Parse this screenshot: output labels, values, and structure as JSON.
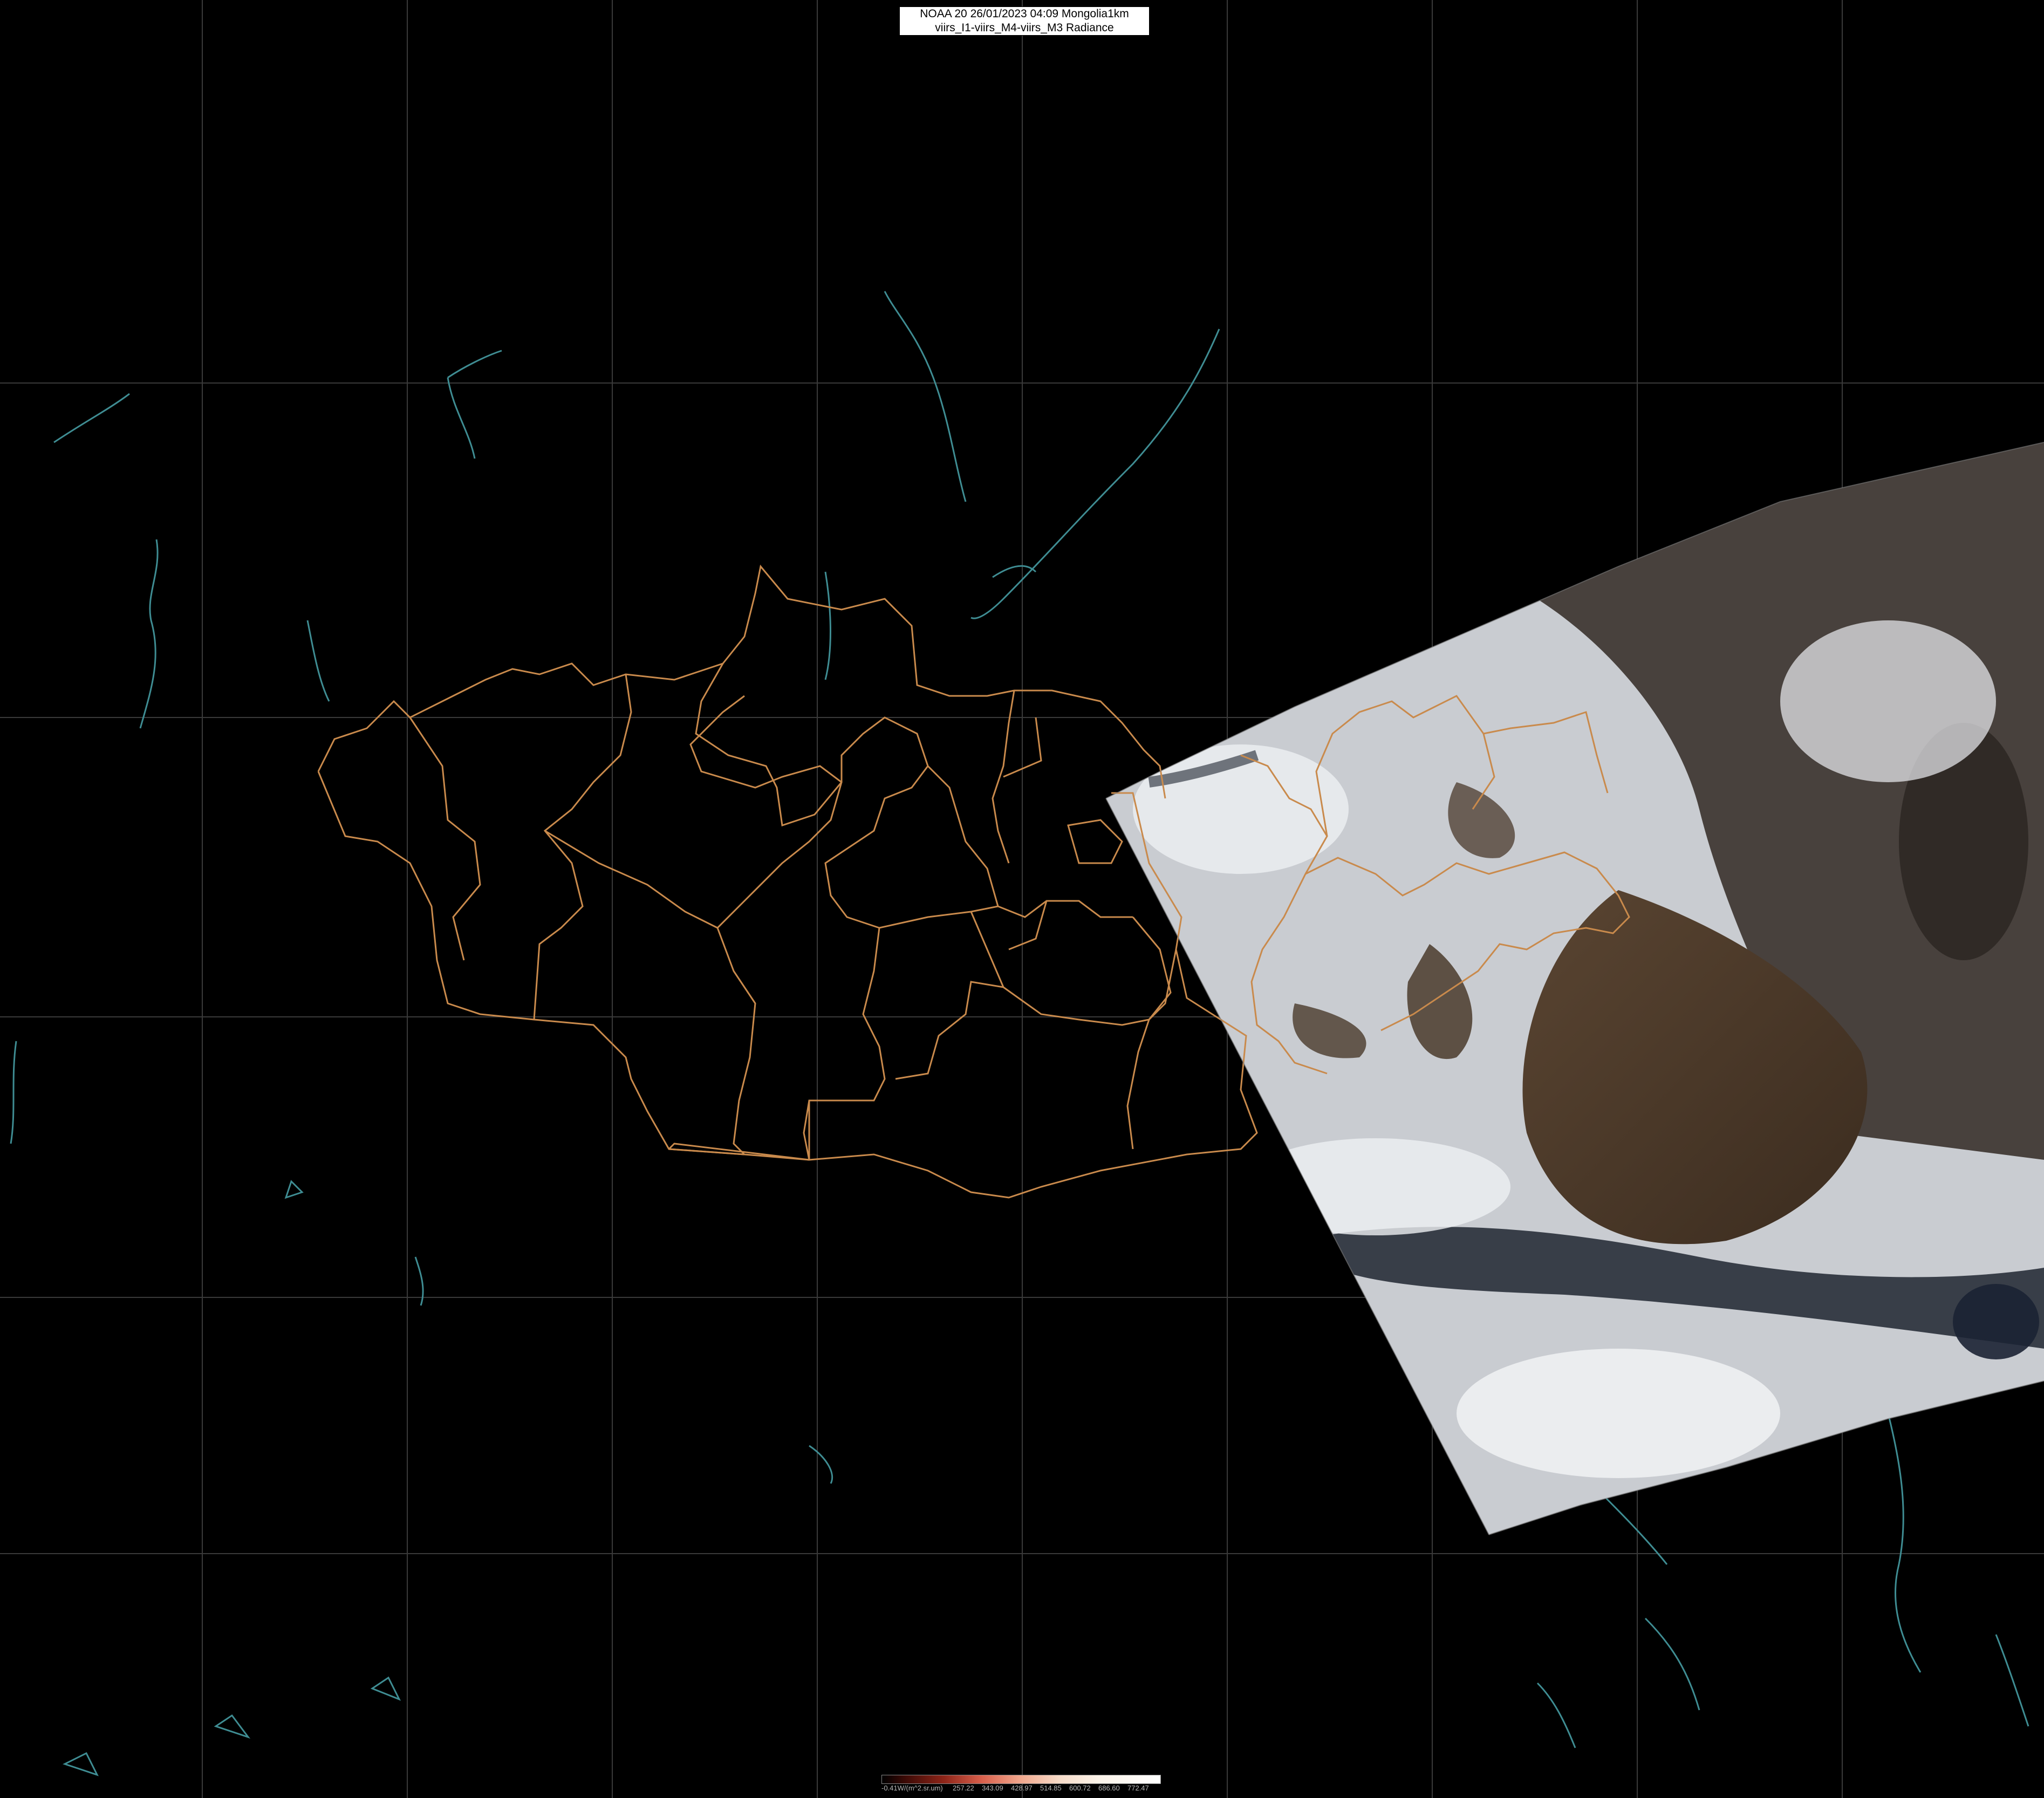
{
  "title": {
    "line1": "NOAA 20 26/01/2023 04:09 Mongolia1km",
    "line2": "viirs_I1-viirs_M4-viirs_M3 Radiance"
  },
  "colors": {
    "background": "#000000",
    "graticule": "#3a3a3a",
    "admin_borders": "#c98a4c",
    "coastlines_water": "#3f8d93",
    "snow_cloud": "#e6e8ec",
    "bare_land": "#4d3b2a"
  },
  "colorbar": {
    "unit_label": "-0.41W/(m^2.sr.um)",
    "ticks": [
      "257.22",
      "343.09",
      "428.97",
      "514.85",
      "600.72",
      "686.60",
      "772.47"
    ]
  },
  "layers": [
    "graticule",
    "mongolia-aimag-borders",
    "lakes-and-rivers",
    "viirs-swath-image"
  ]
}
